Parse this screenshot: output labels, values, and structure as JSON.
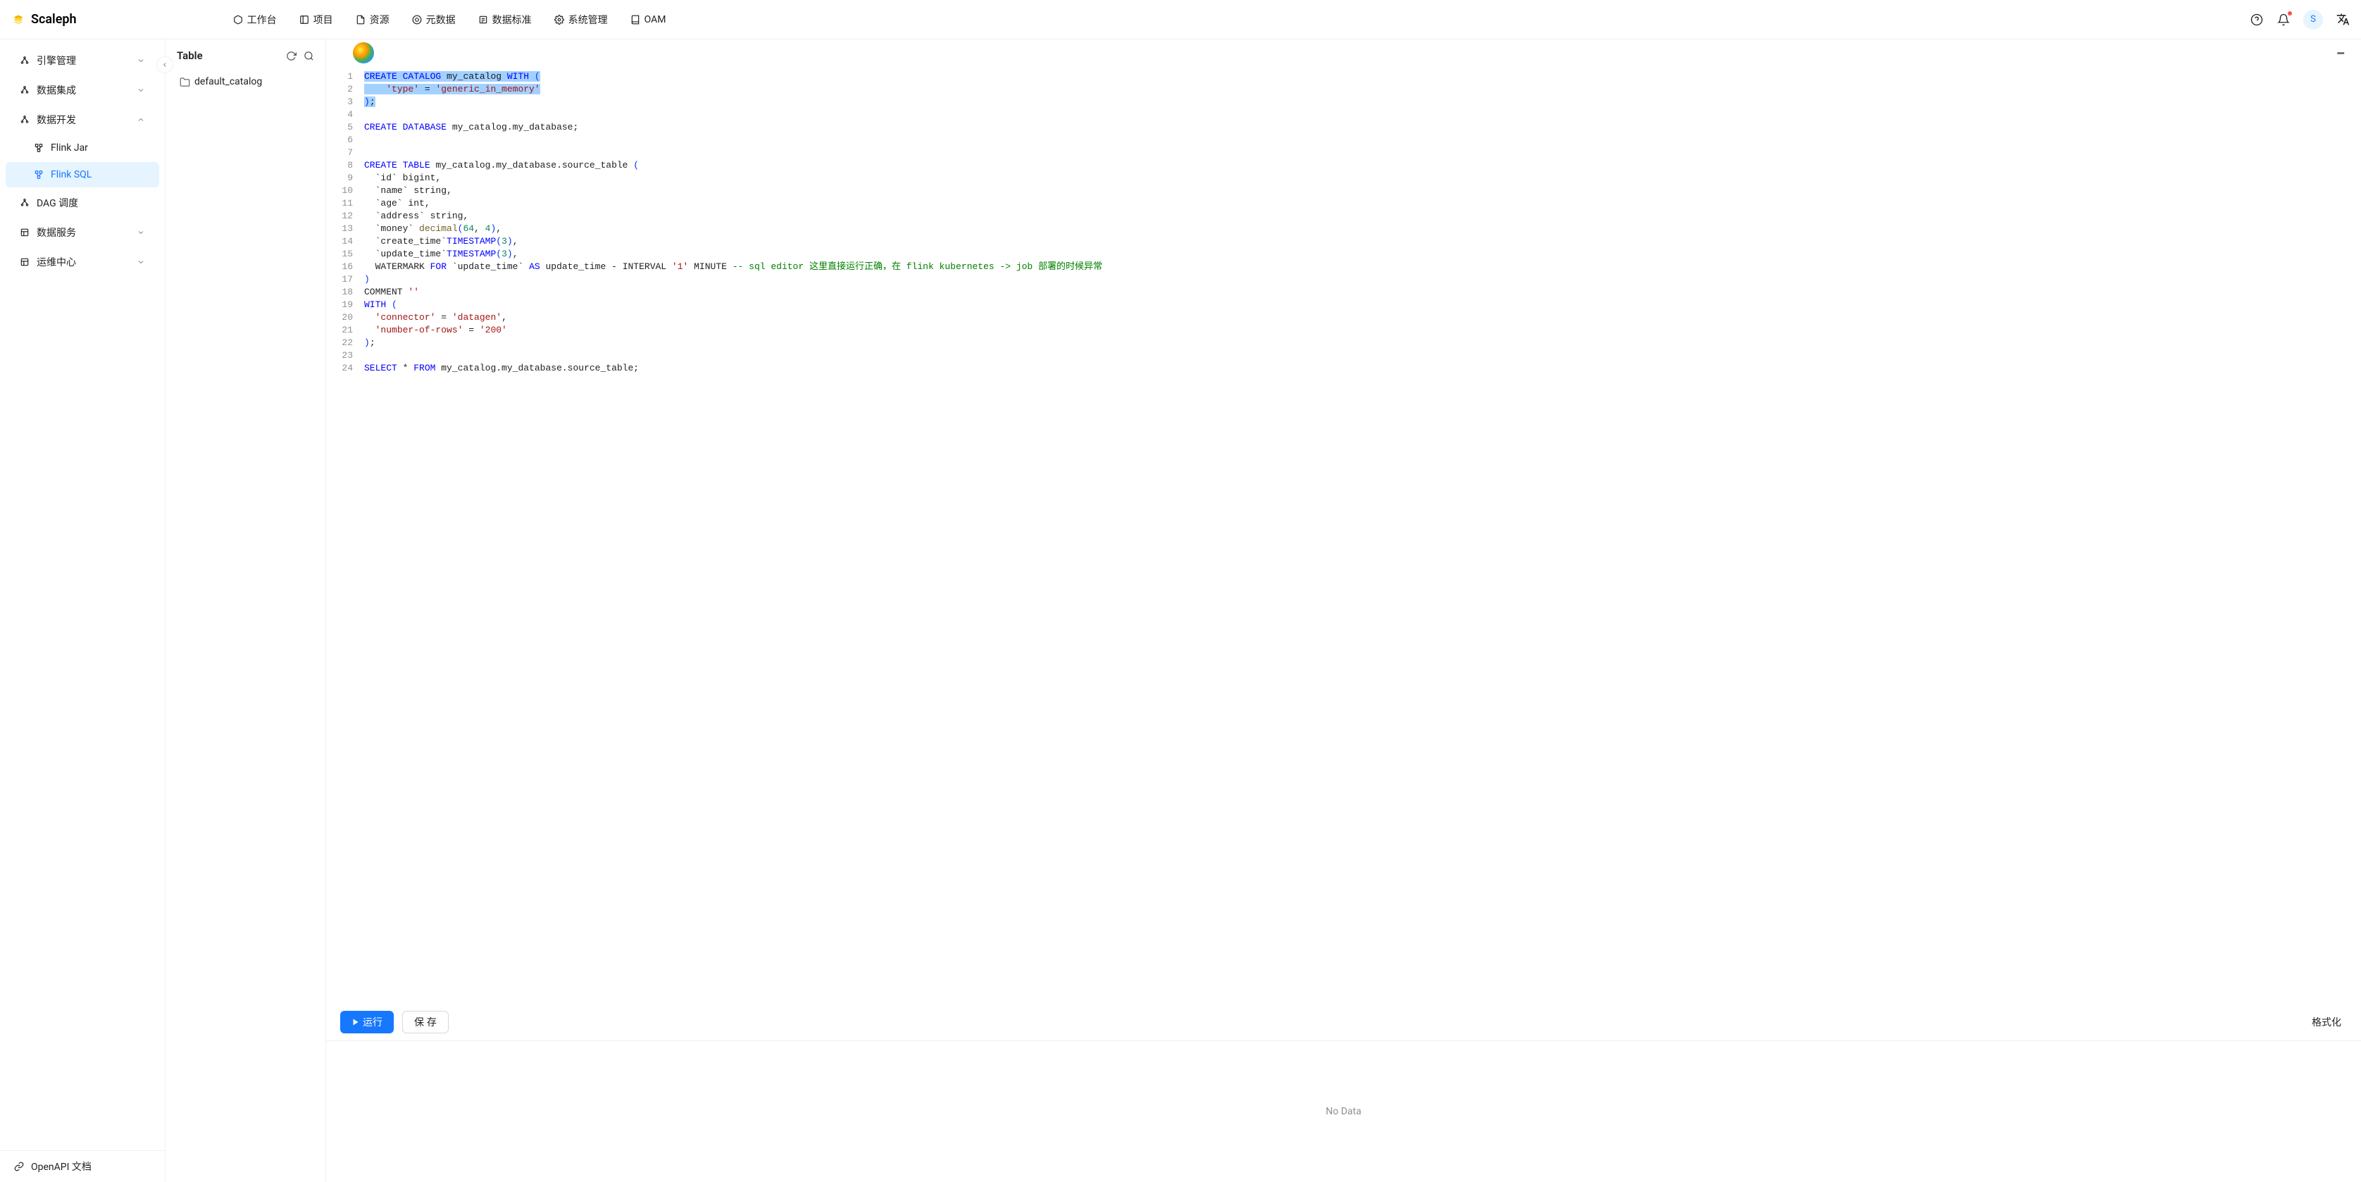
{
  "app": {
    "name": "Scaleph"
  },
  "nav": {
    "items": [
      {
        "label": "工作台"
      },
      {
        "label": "项目"
      },
      {
        "label": "资源"
      },
      {
        "label": "元数据"
      },
      {
        "label": "数据标准"
      },
      {
        "label": "系统管理"
      },
      {
        "label": "OAM"
      }
    ]
  },
  "header_right": {
    "avatar_letter": "S"
  },
  "sidebar": {
    "items": [
      {
        "label": "引擎管理",
        "expandable": true,
        "expanded": false
      },
      {
        "label": "数据集成",
        "expandable": true,
        "expanded": false
      },
      {
        "label": "数据开发",
        "expandable": true,
        "expanded": true,
        "children": [
          {
            "label": "Flink Jar",
            "active": false
          },
          {
            "label": "Flink SQL",
            "active": true
          }
        ]
      },
      {
        "label": "DAG 调度",
        "expandable": false
      },
      {
        "label": "数据服务",
        "expandable": true,
        "expanded": false
      },
      {
        "label": "运维中心",
        "expandable": true,
        "expanded": false
      }
    ],
    "footer": {
      "label": "OpenAPI 文档"
    }
  },
  "table_panel": {
    "title": "Table",
    "tree": [
      {
        "label": "default_catalog"
      }
    ]
  },
  "editor": {
    "code_lines": [
      {
        "n": 1,
        "selected": true,
        "tokens": [
          {
            "t": "CREATE",
            "c": "tok-kw"
          },
          {
            "t": " "
          },
          {
            "t": "CATALOG",
            "c": "tok-kw"
          },
          {
            "t": " my_catalog "
          },
          {
            "t": "WITH",
            "c": "tok-kw"
          },
          {
            "t": " "
          },
          {
            "t": "(",
            "c": "tok-paren"
          }
        ]
      },
      {
        "n": 2,
        "selected": true,
        "tokens": [
          {
            "t": "    "
          },
          {
            "t": "'type'",
            "c": "tok-str"
          },
          {
            "t": " = "
          },
          {
            "t": "'generic_in_memory'",
            "c": "tok-str"
          }
        ]
      },
      {
        "n": 3,
        "selected_partial": true,
        "tokens": [
          {
            "t": ")",
            "c": "tok-paren"
          },
          {
            "t": ";"
          }
        ]
      },
      {
        "n": 4,
        "tokens": []
      },
      {
        "n": 5,
        "tokens": [
          {
            "t": "CREATE",
            "c": "tok-kw"
          },
          {
            "t": " "
          },
          {
            "t": "DATABASE",
            "c": "tok-kw"
          },
          {
            "t": " my_catalog.my_database;"
          }
        ]
      },
      {
        "n": 6,
        "tokens": []
      },
      {
        "n": 7,
        "tokens": []
      },
      {
        "n": 8,
        "tokens": [
          {
            "t": "CREATE",
            "c": "tok-kw"
          },
          {
            "t": " "
          },
          {
            "t": "TABLE",
            "c": "tok-kw"
          },
          {
            "t": " my_catalog.my_database.source_table "
          },
          {
            "t": "(",
            "c": "tok-paren"
          }
        ]
      },
      {
        "n": 9,
        "tokens": [
          {
            "t": "  `id` bigint,"
          }
        ]
      },
      {
        "n": 10,
        "tokens": [
          {
            "t": "  `name` string,"
          }
        ]
      },
      {
        "n": 11,
        "tokens": [
          {
            "t": "  `age` int,"
          }
        ]
      },
      {
        "n": 12,
        "tokens": [
          {
            "t": "  `address` string,"
          }
        ]
      },
      {
        "n": 13,
        "tokens": [
          {
            "t": "  `money` "
          },
          {
            "t": "decimal",
            "c": "tok-fn"
          },
          {
            "t": "(",
            "c": "tok-paren"
          },
          {
            "t": "64",
            "c": "tok-num"
          },
          {
            "t": ", "
          },
          {
            "t": "4",
            "c": "tok-num"
          },
          {
            "t": ")",
            "c": "tok-paren"
          },
          {
            "t": ","
          }
        ]
      },
      {
        "n": 14,
        "tokens": [
          {
            "t": "  `create_time`"
          },
          {
            "t": "TIMESTAMP",
            "c": "tok-kw"
          },
          {
            "t": "(",
            "c": "tok-paren"
          },
          {
            "t": "3",
            "c": "tok-num"
          },
          {
            "t": ")",
            "c": "tok-paren"
          },
          {
            "t": ","
          }
        ]
      },
      {
        "n": 15,
        "tokens": [
          {
            "t": "  `update_time`"
          },
          {
            "t": "TIMESTAMP",
            "c": "tok-kw"
          },
          {
            "t": "(",
            "c": "tok-paren"
          },
          {
            "t": "3",
            "c": "tok-num"
          },
          {
            "t": ")",
            "c": "tok-paren"
          },
          {
            "t": ","
          }
        ]
      },
      {
        "n": 16,
        "tokens": [
          {
            "t": "  WATERMARK "
          },
          {
            "t": "FOR",
            "c": "tok-kw"
          },
          {
            "t": " `update_time` "
          },
          {
            "t": "AS",
            "c": "tok-kw"
          },
          {
            "t": " update_time - INTERVAL "
          },
          {
            "t": "'1'",
            "c": "tok-str"
          },
          {
            "t": " MINUTE "
          },
          {
            "t": "-- sql editor 这里直接运行正确，在 flink kubernetes -> job 部署的时候异常",
            "c": "tok-comment"
          }
        ]
      },
      {
        "n": 17,
        "tokens": [
          {
            "t": ")",
            "c": "tok-paren"
          }
        ]
      },
      {
        "n": 18,
        "tokens": [
          {
            "t": "COMMENT "
          },
          {
            "t": "''",
            "c": "tok-str"
          }
        ]
      },
      {
        "n": 19,
        "tokens": [
          {
            "t": "WITH",
            "c": "tok-kw"
          },
          {
            "t": " "
          },
          {
            "t": "(",
            "c": "tok-paren"
          }
        ]
      },
      {
        "n": 20,
        "tokens": [
          {
            "t": "  "
          },
          {
            "t": "'connector'",
            "c": "tok-str"
          },
          {
            "t": " = "
          },
          {
            "t": "'datagen'",
            "c": "tok-str"
          },
          {
            "t": ","
          }
        ]
      },
      {
        "n": 21,
        "tokens": [
          {
            "t": "  "
          },
          {
            "t": "'number-of-rows'",
            "c": "tok-str"
          },
          {
            "t": " = "
          },
          {
            "t": "'200'",
            "c": "tok-str"
          }
        ]
      },
      {
        "n": 22,
        "tokens": [
          {
            "t": ")",
            "c": "tok-paren"
          },
          {
            "t": ";"
          }
        ]
      },
      {
        "n": 23,
        "tokens": []
      },
      {
        "n": 24,
        "tokens": [
          {
            "t": "SELECT",
            "c": "tok-kw"
          },
          {
            "t": " * "
          },
          {
            "t": "FROM",
            "c": "tok-kw"
          },
          {
            "t": " my_catalog.my_database.source_table;"
          }
        ]
      }
    ]
  },
  "toolbar": {
    "run_label": "运行",
    "save_label": "保 存",
    "format_label": "格式化"
  },
  "results": {
    "empty_text": "No Data"
  }
}
